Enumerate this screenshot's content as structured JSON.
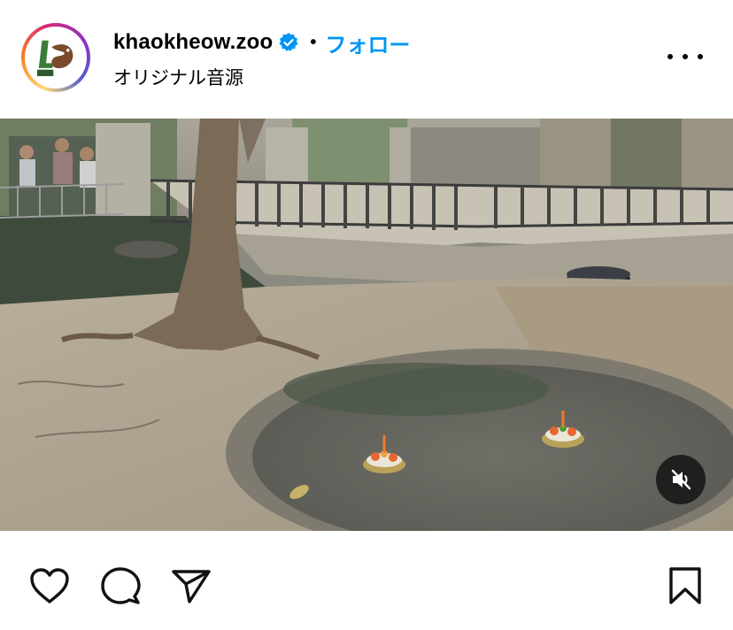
{
  "post": {
    "username": "khaokheow.zoo",
    "verified": true,
    "separator": "•",
    "follow_label": "フォロー",
    "audio_label": "オリジナル音源",
    "avatar_icon": "khaokheow-zoo-logo",
    "media_type": "video",
    "muted": true
  },
  "actions": {
    "like_icon": "heart-outline-icon",
    "comment_icon": "comment-bubble-icon",
    "share_icon": "paper-plane-icon",
    "save_icon": "bookmark-outline-icon"
  },
  "colors": {
    "follow": "#0095f6",
    "verified": "#0095f6"
  }
}
